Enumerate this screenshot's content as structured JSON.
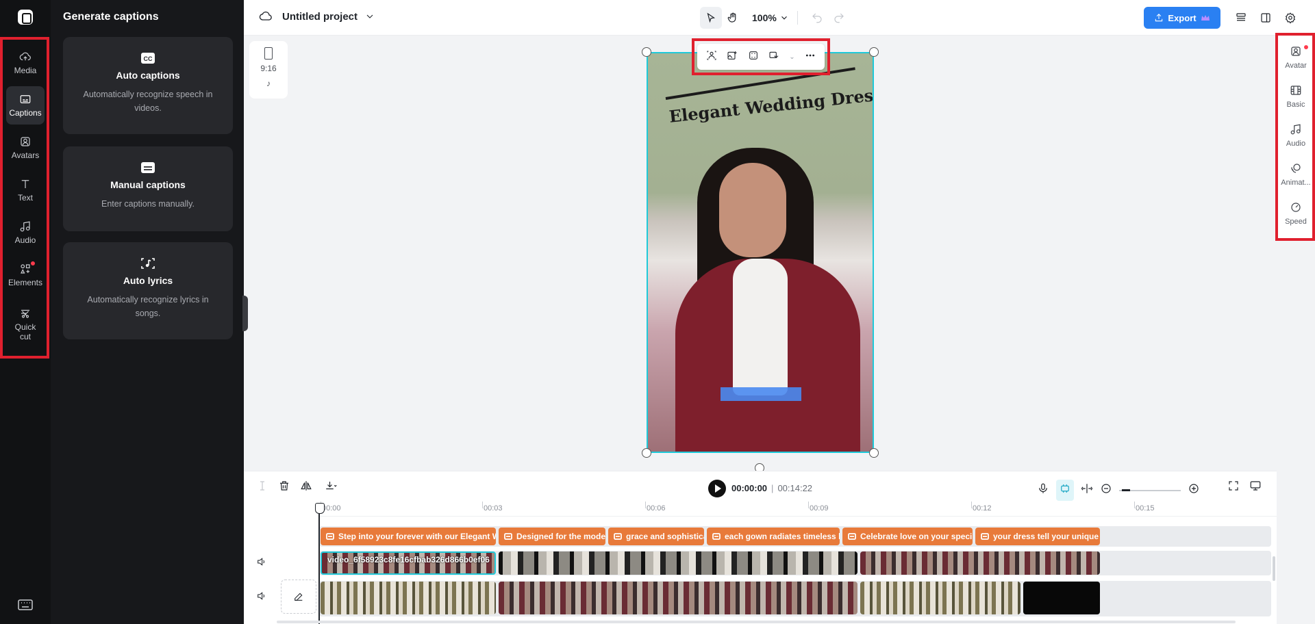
{
  "app": {
    "project_title": "Untitled project",
    "zoom_level": "100%",
    "export_label": "Export"
  },
  "left_rail": {
    "items": [
      {
        "label": "Media",
        "icon": "cloud-upload-icon"
      },
      {
        "label": "Captions",
        "icon": "captions-icon",
        "active": true
      },
      {
        "label": "Avatars",
        "icon": "avatar-icon"
      },
      {
        "label": "Text",
        "icon": "text-icon"
      },
      {
        "label": "Audio",
        "icon": "music-note-icon"
      },
      {
        "label": "Elements",
        "icon": "elements-icon",
        "badge": true
      },
      {
        "label": "Quick cut",
        "icon": "scissors-icon"
      }
    ]
  },
  "captions_panel": {
    "title": "Generate captions",
    "cards": [
      {
        "title": "Auto captions",
        "desc": "Automatically recognize speech in videos.",
        "icon": "cc-icon"
      },
      {
        "title": "Manual captions",
        "desc": "Enter captions manually.",
        "icon": "keyboard-captions-icon"
      },
      {
        "title": "Auto lyrics",
        "desc": "Automatically recognize lyrics in songs.",
        "icon": "lyrics-icon"
      }
    ]
  },
  "aspect_ratio": {
    "label": "9:16",
    "platform_icon": "tiktok-icon"
  },
  "preview": {
    "overlay_title": "Elegant Wedding Dresses"
  },
  "right_rail": {
    "items": [
      {
        "label": "Avatar",
        "badge": true
      },
      {
        "label": "Basic"
      },
      {
        "label": "Audio"
      },
      {
        "label": "Animat..."
      },
      {
        "label": "Speed"
      }
    ]
  },
  "timeline": {
    "current_time": "00:00:00",
    "total_time": "00:14:22",
    "ticks": [
      "00:00",
      "00:03",
      "00:06",
      "00:09",
      "00:12",
      "00:15"
    ],
    "caption_clips": [
      "Step into your forever with our Elegant W",
      "Designed for the mode",
      "grace and sophistica",
      "each gown radiates timeless be",
      "Celebrate love on your speci",
      "your dress tell your unique"
    ],
    "video_clip_name": "video_6f58923c8fe16cfbab326d866b0ef06"
  },
  "colors": {
    "accent": "#2a80f2",
    "selection": "#1fc9d9",
    "caption_clip": "#e87a3a",
    "highlight_box": "#e0202e"
  }
}
